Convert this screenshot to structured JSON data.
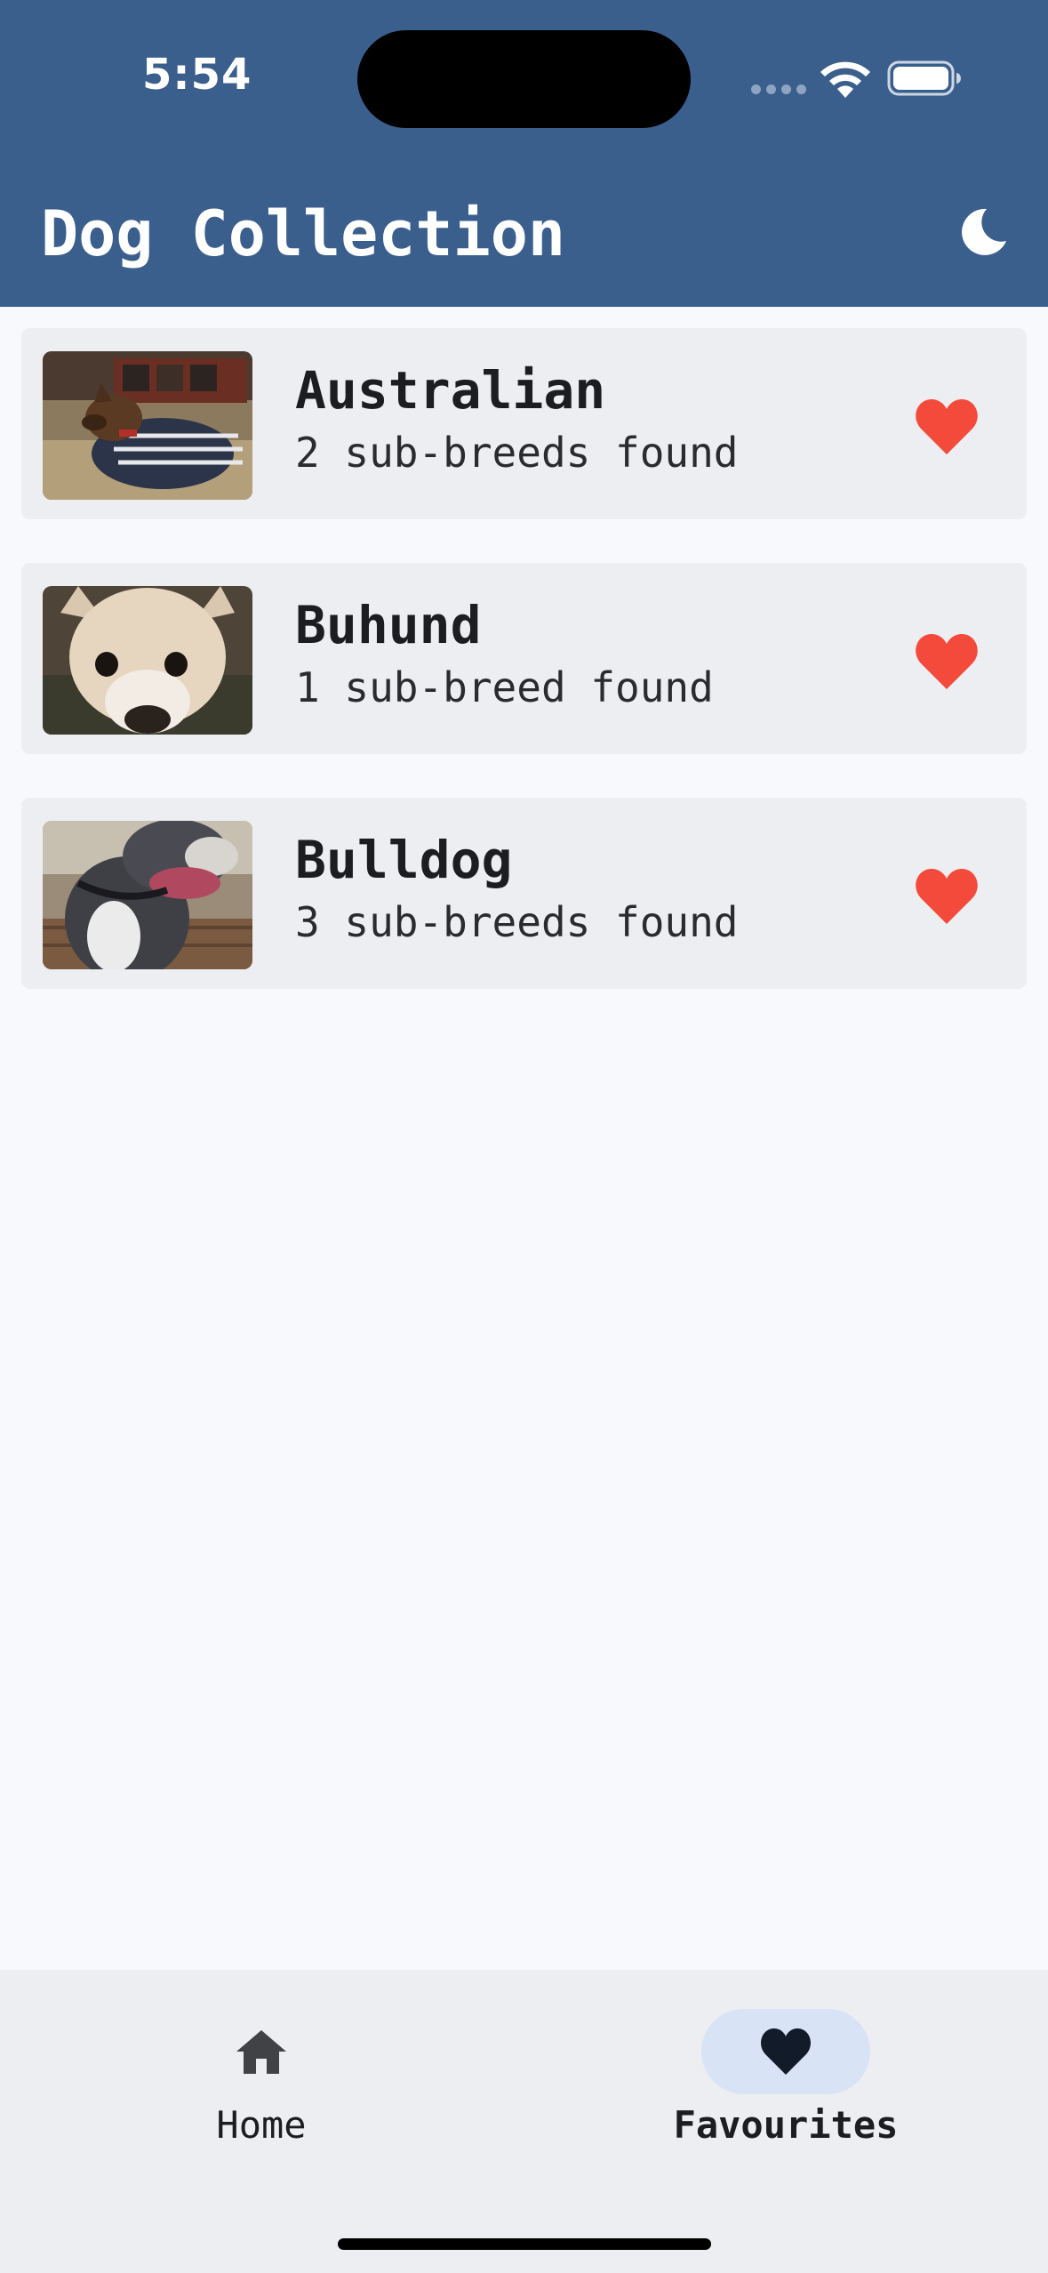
{
  "status_bar": {
    "time": "5:54"
  },
  "header": {
    "title": "Dog Collection",
    "theme_icon": "moon-icon"
  },
  "colors": {
    "header_bg": "#3b5f8d",
    "page_bg": "#f7f9fd",
    "card_bg": "#edeef2",
    "heart": "#f34a3c",
    "nav_pill": "#d8e3f6"
  },
  "breeds": [
    {
      "name": "Australian",
      "subtitle": "2 sub-breeds found",
      "favourite_icon": "heart-icon"
    },
    {
      "name": "Buhund",
      "subtitle": "1 sub-breed found",
      "favourite_icon": "heart-icon"
    },
    {
      "name": "Bulldog",
      "subtitle": "3 sub-breeds found",
      "favourite_icon": "heart-icon"
    }
  ],
  "bottom_nav": {
    "items": [
      {
        "label": "Home",
        "icon": "home-icon",
        "active": false
      },
      {
        "label": "Favourites",
        "icon": "heart-icon",
        "active": true
      }
    ]
  }
}
